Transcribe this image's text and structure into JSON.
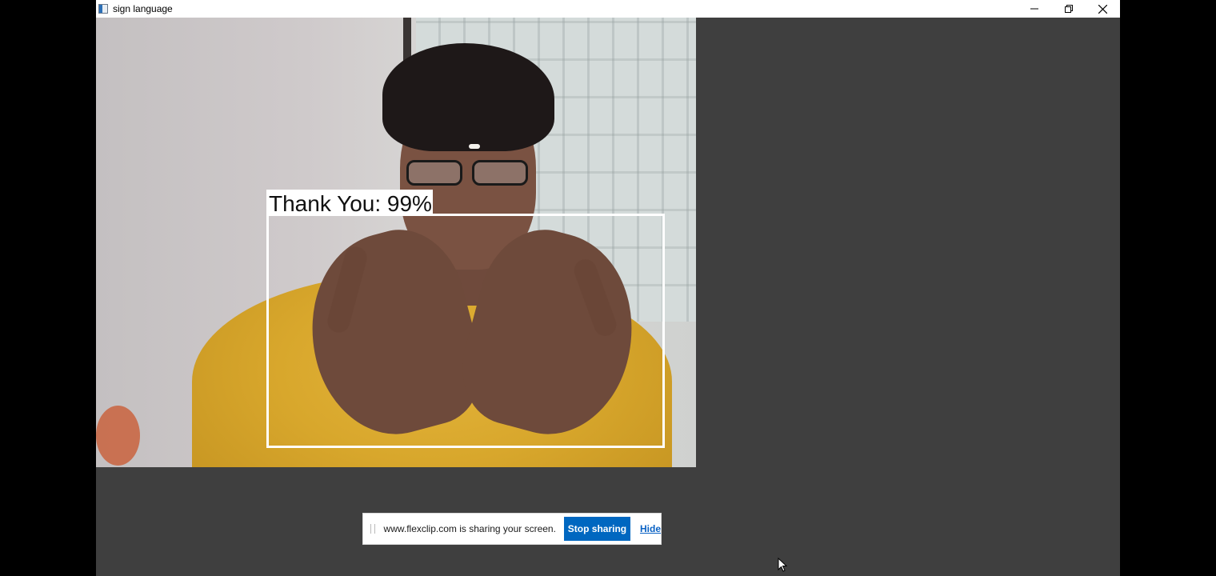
{
  "window": {
    "title": "sign language",
    "app_icon": "window-app-icon",
    "controls": [
      "minimize-icon",
      "restore-icon",
      "close-icon"
    ]
  },
  "video": {
    "detection_label": "Thank You: 99%",
    "box_color": "#ffffff"
  },
  "share_bar": {
    "message": "www.flexclip.com is sharing your screen.",
    "stop_label": "Stop sharing",
    "hide_label": "Hide",
    "accent": "#0067c0"
  },
  "colors": {
    "window_bg": "#3f3f3f",
    "desktop_bg": "#000000"
  }
}
